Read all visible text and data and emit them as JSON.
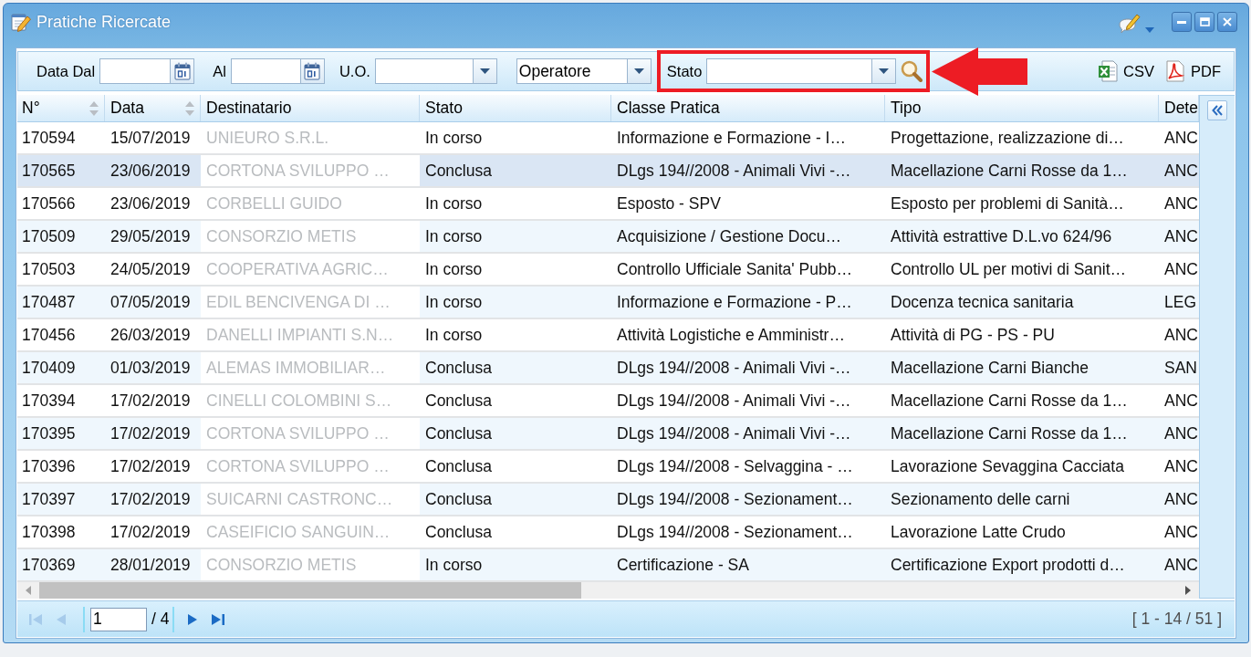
{
  "window": {
    "title": "Pratiche Ricercate"
  },
  "toolbar": {
    "filters": [
      {
        "kind": "date",
        "label": "Data Dal",
        "highlighted": false
      },
      {
        "kind": "date",
        "label": "Al",
        "highlighted": false
      },
      {
        "kind": "combo",
        "label": "U.O.",
        "highlighted": false
      },
      {
        "kind": "combo",
        "value": "Operatore",
        "highlighted": false
      },
      {
        "kind": "combo",
        "label": "Stato",
        "highlighted": true
      }
    ],
    "exports": [
      {
        "kind": "csv",
        "label": "CSV"
      },
      {
        "kind": "pdf",
        "label": "PDF"
      }
    ]
  },
  "table": {
    "columns": [
      {
        "label": "N°",
        "sortable": true,
        "masked": false
      },
      {
        "label": "Data",
        "sortable": true,
        "masked": false
      },
      {
        "label": "Destinatario",
        "sortable": false,
        "masked": true
      },
      {
        "label": "Stato",
        "sortable": false,
        "masked": false
      },
      {
        "label": "Classe Pratica",
        "sortable": false,
        "masked": false
      },
      {
        "label": "Tipo",
        "sortable": false,
        "masked": false
      },
      {
        "label": "Dete",
        "sortable": false,
        "masked": false
      }
    ],
    "rows": [
      {
        "selected": false,
        "cells": [
          "170594",
          "15/07/2019",
          "UNIEURO S.R.L.",
          "In corso",
          "Informazione e Formazione - I…",
          "Progettazione, realizzazione di…",
          "ANC"
        ]
      },
      {
        "selected": true,
        "cells": [
          "170565",
          "23/06/2019",
          "CORTONA SVILUPPO …",
          "Conclusa",
          "DLgs 194//2008 - Animali Vivi -…",
          "Macellazione Carni Rosse da 1…",
          "ANC"
        ]
      },
      {
        "selected": false,
        "cells": [
          "170566",
          "23/06/2019",
          "CORBELLI GUIDO",
          "In corso",
          "Esposto - SPV",
          "Esposto per problemi di Sanità…",
          "ANC"
        ]
      },
      {
        "selected": false,
        "cells": [
          "170509",
          "29/05/2019",
          "CONSORZIO METIS",
          "In corso",
          "Acquisizione / Gestione Docu…",
          "Attività estrattive D.L.vo 624/96",
          "ANC"
        ]
      },
      {
        "selected": false,
        "cells": [
          "170503",
          "24/05/2019",
          "COOPERATIVA AGRIC…",
          "In corso",
          "Controllo Ufficiale Sanita' Pubb…",
          "Controllo UL per motivi di Sanit…",
          "ANC"
        ]
      },
      {
        "selected": false,
        "cells": [
          "170487",
          "07/05/2019",
          "EDIL BENCIVENGA DI …",
          "In corso",
          "Informazione e Formazione - P…",
          "Docenza tecnica sanitaria",
          "LEG"
        ]
      },
      {
        "selected": false,
        "cells": [
          "170456",
          "26/03/2019",
          "DANELLI IMPIANTI S.N…",
          "In corso",
          "Attività Logistiche e Amministr…",
          "Attività di PG - PS - PU",
          "ANC"
        ]
      },
      {
        "selected": false,
        "cells": [
          "170409",
          "01/03/2019",
          "ALEMAS IMMOBILIAR…",
          "Conclusa",
          "DLgs 194//2008 - Animali Vivi -…",
          "Macellazione Carni Bianche",
          "SAN"
        ]
      },
      {
        "selected": false,
        "cells": [
          "170394",
          "17/02/2019",
          "CINELLI COLOMBINI S…",
          "Conclusa",
          "DLgs 194//2008 - Animali Vivi -…",
          "Macellazione Carni Rosse da 1…",
          "ANC"
        ]
      },
      {
        "selected": false,
        "cells": [
          "170395",
          "17/02/2019",
          "CORTONA SVILUPPO …",
          "Conclusa",
          "DLgs 194//2008 - Animali Vivi -…",
          "Macellazione Carni Rosse da 1…",
          "ANC"
        ]
      },
      {
        "selected": false,
        "cells": [
          "170396",
          "17/02/2019",
          "CORTONA SVILUPPO …",
          "Conclusa",
          "DLgs 194//2008 - Selvaggina - …",
          "Lavorazione Sevaggina Cacciata",
          "ANC"
        ]
      },
      {
        "selected": false,
        "cells": [
          "170397",
          "17/02/2019",
          "SUICARNI CASTRONC…",
          "Conclusa",
          "DLgs 194//2008 - Sezionament…",
          "Sezionamento delle carni",
          "ANC"
        ]
      },
      {
        "selected": false,
        "cells": [
          "170398",
          "17/02/2019",
          "CASEIFICIO SANGUIN…",
          "Conclusa",
          "DLgs 194//2008 - Sezionament…",
          "Lavorazione Latte Crudo",
          "ANC"
        ]
      },
      {
        "selected": false,
        "cells": [
          "170369",
          "28/01/2019",
          "CONSORZIO METIS",
          "In corso",
          "Certificazione - SA",
          "Certificazione Export prodotti d…",
          "ANC"
        ]
      }
    ]
  },
  "pager": {
    "nav_back": [
      {
        "kind": "first",
        "disabled": true
      },
      {
        "kind": "prev",
        "disabled": true
      }
    ],
    "page": "1",
    "page_count": "/ 4",
    "nav_forward": [
      {
        "kind": "next",
        "disabled": false
      },
      {
        "kind": "last",
        "disabled": false
      }
    ],
    "summary": "[ 1 - 14 / 51 ]"
  }
}
